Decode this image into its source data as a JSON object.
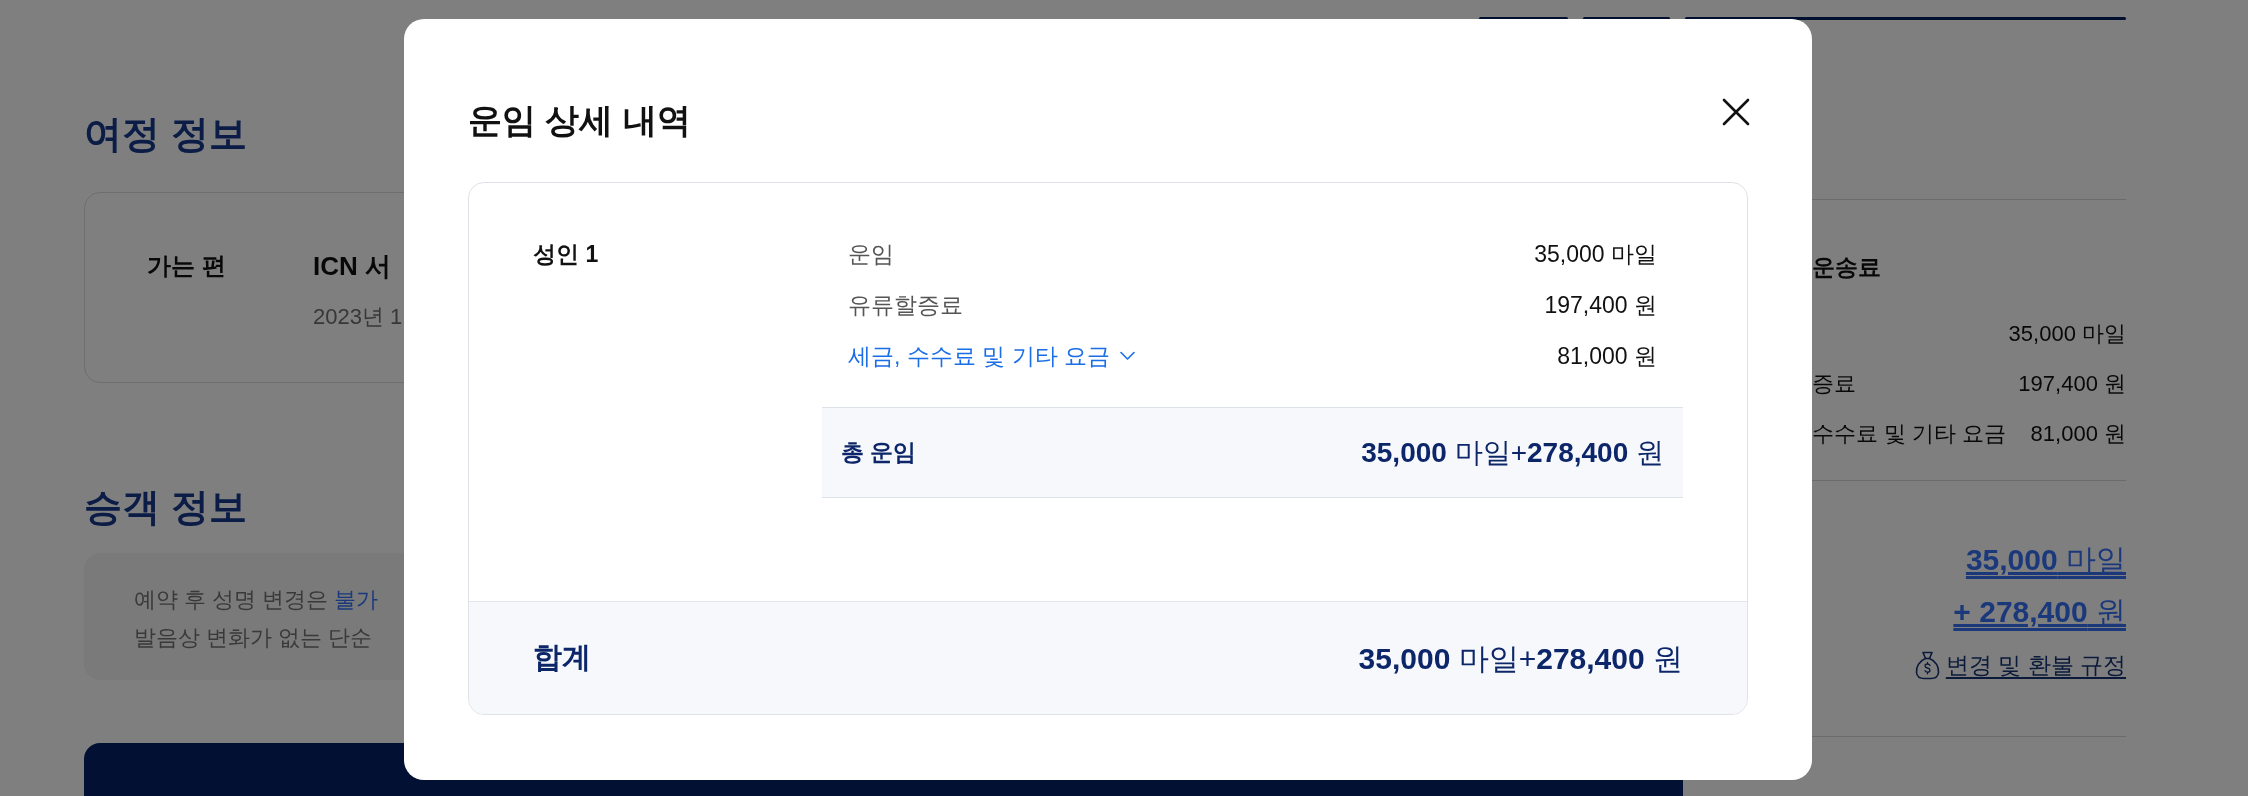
{
  "background_page": {
    "trip_section": {
      "title": "여정 정보",
      "segment_label": "가는 편",
      "route": "ICN 서",
      "date": "2023년 1"
    },
    "passenger_section": {
      "title": "승객 정보",
      "notice_lines": [
        [
          {
            "text": "예약 후 성명 변경은 ",
            "kind": "plain"
          },
          {
            "text": "불가",
            "kind": "link"
          }
        ],
        [
          {
            "text": "발음상 변화가 없는 단순",
            "kind": "plain"
          }
        ]
      ]
    },
    "fare_summary": {
      "title": "운송료",
      "items": [
        {
          "value": "35,000 마일"
        },
        {
          "label": "증료",
          "value": "197,400 원"
        },
        {
          "label": "수수료 및 기타 요금",
          "value": "81,000 원"
        }
      ],
      "total_miles": "**35,000** 마일",
      "total_won": "**+ 278,400** 원",
      "policy_link": "변경 및 환불 규정"
    }
  },
  "dialog": {
    "title": "운임 상세 내역",
    "passenger": "성인 1",
    "rows": [
      {
        "kind": "plain",
        "label": "운임",
        "value": "35,000 마일"
      },
      {
        "kind": "plain",
        "label": "유류할증료",
        "value": "197,400 원"
      },
      {
        "kind": "expandable",
        "label": "세금, 수수료 및 기타 요금",
        "value": "81,000 원",
        "expanded": false
      }
    ],
    "subtotal": {
      "label": "총 운임",
      "value": "**35,000** 마일+**278,400** 원"
    },
    "total": {
      "label": "합계",
      "value": "**35,000** 마일+**278,400** 원"
    }
  }
}
